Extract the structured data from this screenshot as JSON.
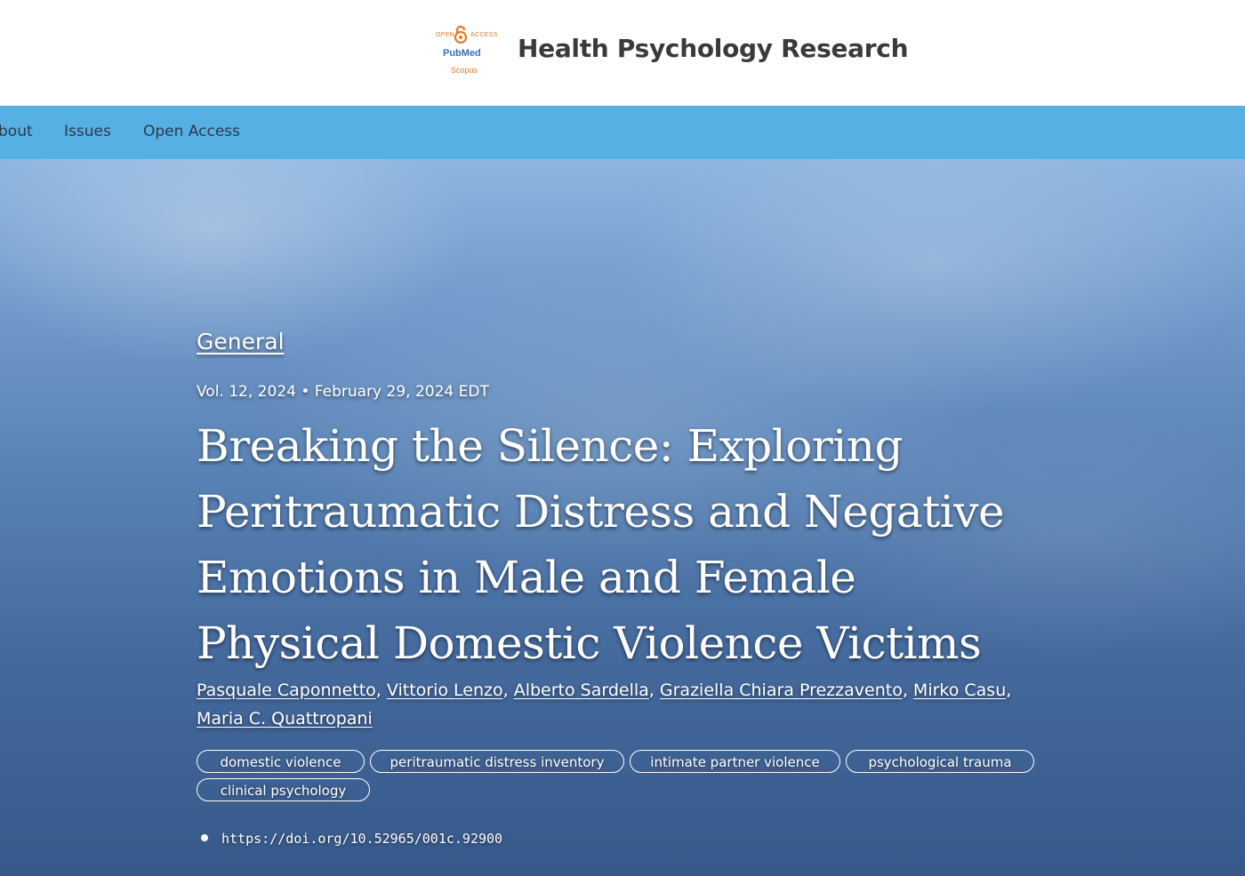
{
  "header": {
    "site_title": "Health Psychology Research",
    "logo": {
      "open_text": "OPEN",
      "access_text": "ACCESS",
      "pubmed_text": "PubMed",
      "scopus_text": "Scopus",
      "brand_color": "#e07a26",
      "pubmed_color": "#3a6fb5"
    }
  },
  "nav": {
    "background": "#56b0e4",
    "items": [
      {
        "label": "bout"
      },
      {
        "label": "Issues"
      },
      {
        "label": "Open Access"
      }
    ]
  },
  "article": {
    "section": "General",
    "meta": "Vol. 12, 2024 • February 29, 2024 EDT",
    "title": "Breaking the Silence: Exploring Peritraumatic Distress and Negative Emotions in Male and Female Physical Domestic Violence Victims",
    "authors": [
      "Pasquale Caponnetto",
      "Vittorio Lenzo",
      "Alberto Sardella",
      "Graziella Chiara Prezzavento",
      "Mirko Casu",
      "Maria C. Quattropani"
    ],
    "author_separator": ",",
    "keywords": [
      "domestic violence",
      "peritraumatic distress inventory",
      "intimate partner violence",
      "psychological trauma",
      "clinical psychology"
    ],
    "doi": "https://doi.org/10.52965/001c.92900"
  }
}
